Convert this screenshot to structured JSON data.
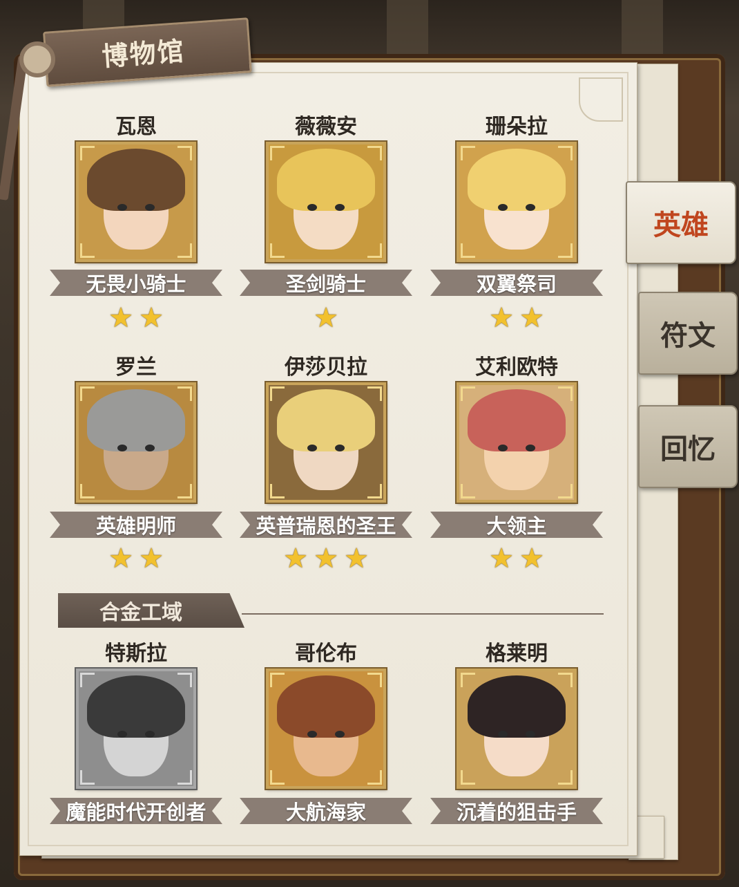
{
  "title": "博物馆",
  "tabs": [
    {
      "label": "英雄",
      "active": true
    },
    {
      "label": "符文",
      "active": false
    },
    {
      "label": "回忆",
      "active": false
    }
  ],
  "heroes": [
    {
      "name": "瓦恩",
      "title": "无畏小骑士",
      "stars": 2,
      "palette": {
        "bg": "#c79a4a",
        "hair": "#6b4a2e",
        "skin": "#f3d6bd"
      }
    },
    {
      "name": "薇薇安",
      "title": "圣剑骑士",
      "stars": 1,
      "palette": {
        "bg": "#c89a3e",
        "hair": "#e8c45a",
        "skin": "#f4dcc4"
      }
    },
    {
      "name": "珊朵拉",
      "title": "双翼祭司",
      "stars": 2,
      "palette": {
        "bg": "#d1a24d",
        "hair": "#f0d070",
        "skin": "#f8e2cf"
      }
    },
    {
      "name": "罗兰",
      "title": "英雄明师",
      "stars": 2,
      "palette": {
        "bg": "#b88a40",
        "hair": "#9a9a98",
        "skin": "#c9a98a"
      }
    },
    {
      "name": "伊莎贝拉",
      "title": "英普瑞恩的圣王",
      "stars": 3,
      "palette": {
        "bg": "#8a6a3c",
        "hair": "#e9cf7a",
        "skin": "#efd8c2"
      }
    },
    {
      "name": "艾利欧特",
      "title": "大领主",
      "stars": 2,
      "palette": {
        "bg": "#d6b07a",
        "hair": "#c8625a",
        "skin": "#f3d2ad"
      }
    }
  ],
  "section": {
    "label": "合金工域"
  },
  "alloy_heroes": [
    {
      "name": "特斯拉",
      "title": "魔能时代开创者",
      "palette": {
        "bg": "#8e8e8e",
        "hair": "#3a3a3a",
        "skin": "#d4d4d4"
      }
    },
    {
      "name": "哥伦布",
      "title": "大航海家",
      "palette": {
        "bg": "#c9923e",
        "hair": "#8b4a2a",
        "skin": "#e8b98e"
      }
    },
    {
      "name": "格莱明",
      "title": "沉着的狙击手",
      "palette": {
        "bg": "#caa25a",
        "hair": "#2e2424",
        "skin": "#f5dcc8"
      }
    }
  ]
}
